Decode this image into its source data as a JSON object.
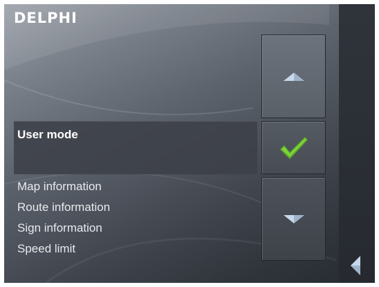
{
  "brand": {
    "logo_text": "DELPHI"
  },
  "list": {
    "selected_item": "User mode",
    "items": [
      "Map information",
      "Route information",
      "Sign information",
      "Speed limit"
    ]
  },
  "icons": {
    "scroll_up": "triangle-up-icon",
    "confirm": "checkmark-icon",
    "scroll_down": "triangle-down-icon",
    "back": "triangle-left-icon"
  },
  "colors": {
    "checkmark": "#6cc22e",
    "arrow": "#c8d8ea",
    "text": "#ffffff"
  }
}
